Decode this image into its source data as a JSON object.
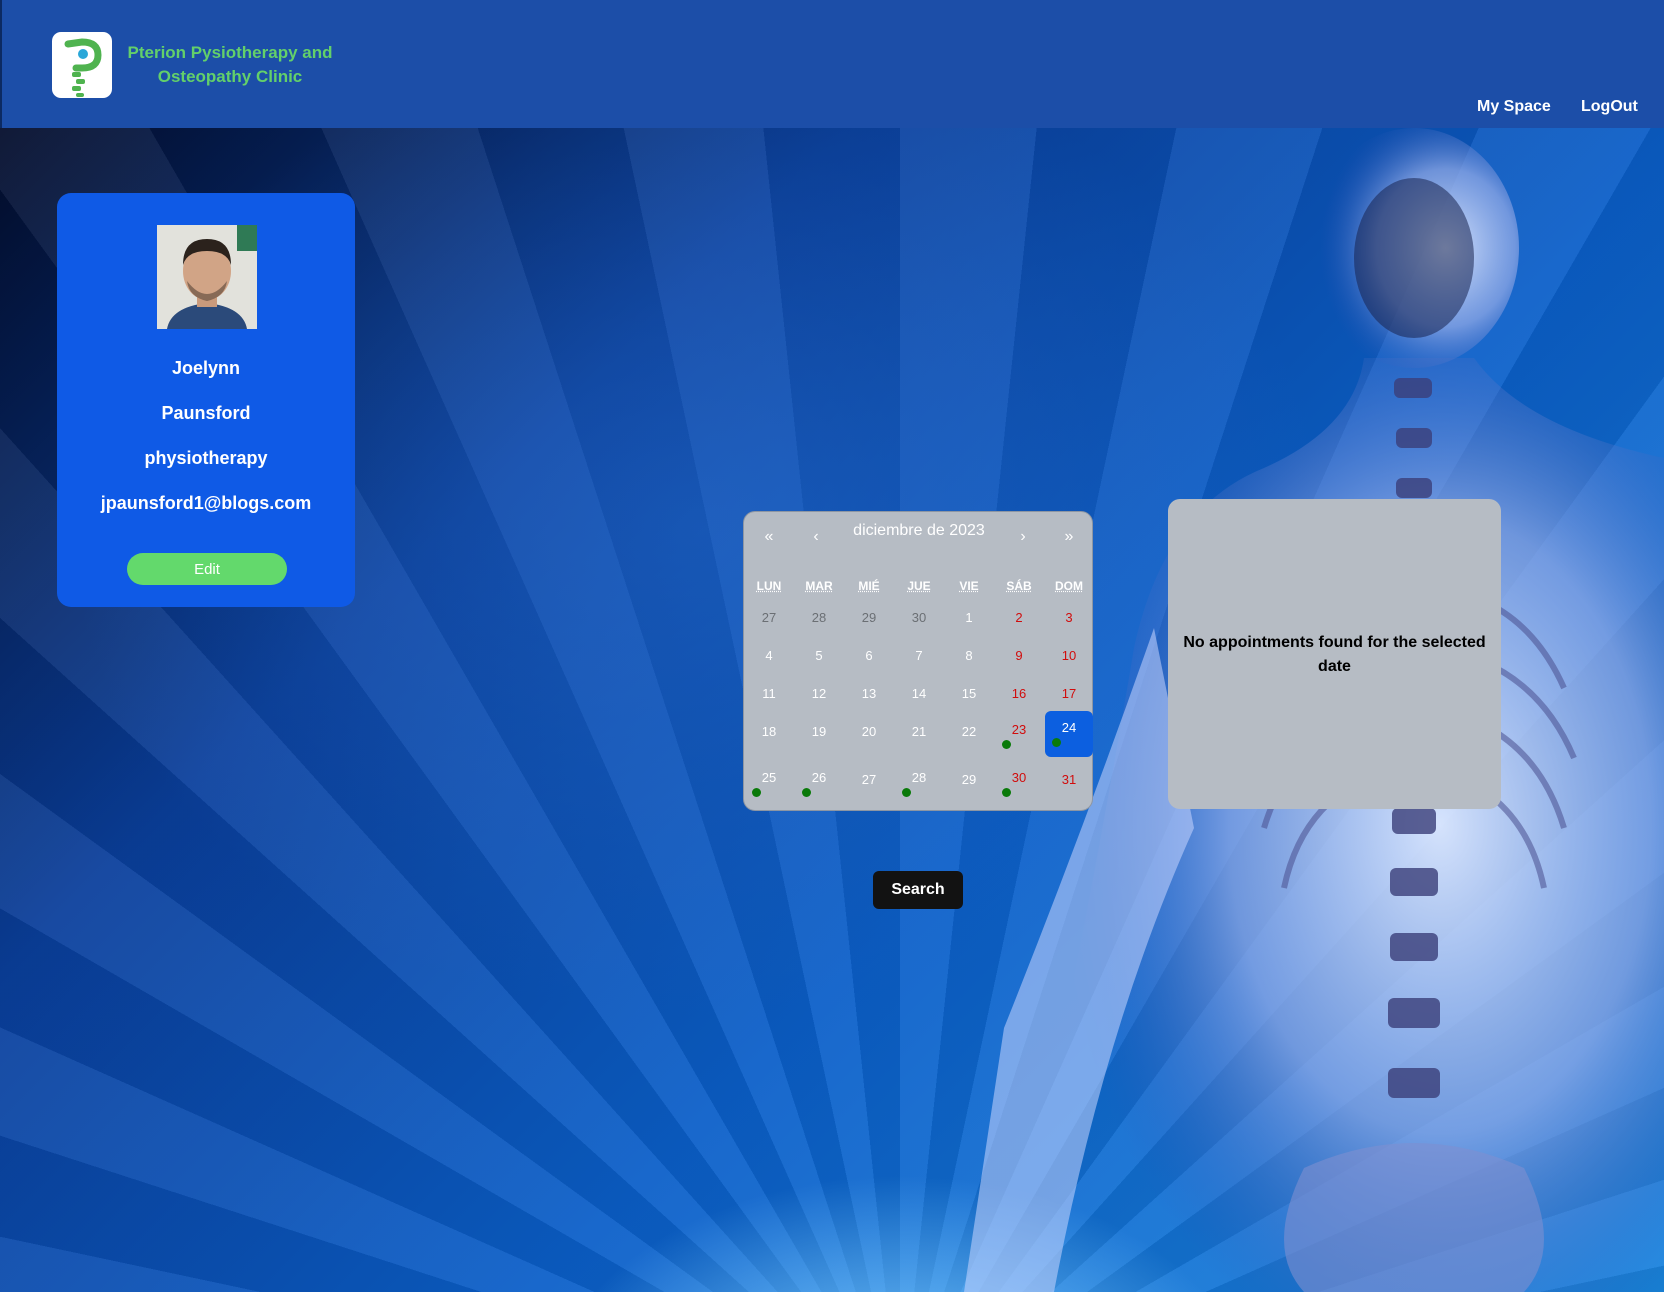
{
  "header": {
    "clinic_name": "Pterion Pysiotherapy and Osteopathy Clinic",
    "nav": {
      "my_space": "My Space",
      "logout": "LogOut"
    },
    "colors": {
      "bar": "#1c4ea8",
      "brand_text": "#63d06a"
    }
  },
  "profile": {
    "first_name": "Joelynn",
    "last_name": "Paunsford",
    "specialty": "physiotherapy",
    "email": "jpaunsford1@blogs.com",
    "edit_label": "Edit"
  },
  "calendar": {
    "title": "diciembre de 2023",
    "nav": {
      "prev_year": "«",
      "prev_month": "‹",
      "next_month": "›",
      "next_year": "»"
    },
    "weekdays": [
      "LUN",
      "MAR",
      "MIÉ",
      "JUE",
      "VIE",
      "SÁB",
      "DOM"
    ],
    "weeks": [
      [
        {
          "d": "27",
          "other": true
        },
        {
          "d": "28",
          "other": true
        },
        {
          "d": "29",
          "other": true
        },
        {
          "d": "30",
          "other": true
        },
        {
          "d": "1"
        },
        {
          "d": "2",
          "weekend": true
        },
        {
          "d": "3",
          "weekend": true
        }
      ],
      [
        {
          "d": "4"
        },
        {
          "d": "5"
        },
        {
          "d": "6"
        },
        {
          "d": "7"
        },
        {
          "d": "8"
        },
        {
          "d": "9",
          "weekend": true
        },
        {
          "d": "10",
          "weekend": true
        }
      ],
      [
        {
          "d": "11"
        },
        {
          "d": "12"
        },
        {
          "d": "13"
        },
        {
          "d": "14"
        },
        {
          "d": "15"
        },
        {
          "d": "16",
          "weekend": true
        },
        {
          "d": "17",
          "weekend": true
        }
      ],
      [
        {
          "d": "18"
        },
        {
          "d": "19"
        },
        {
          "d": "20"
        },
        {
          "d": "21"
        },
        {
          "d": "22"
        },
        {
          "d": "23",
          "weekend": true,
          "dot": true
        },
        {
          "d": "24",
          "weekend": true,
          "dot": true,
          "selected": true
        }
      ],
      [
        {
          "d": "25",
          "dot": true
        },
        {
          "d": "26",
          "dot": true
        },
        {
          "d": "27"
        },
        {
          "d": "28",
          "dot": true
        },
        {
          "d": "29"
        },
        {
          "d": "30",
          "weekend": true,
          "dot": true
        },
        {
          "d": "31",
          "weekend": true
        }
      ]
    ],
    "colors": {
      "selected": "#0c5fe0",
      "weekend": "#d10c0c",
      "dot": "#0a7a0a"
    }
  },
  "appointments": {
    "empty_message": "No appointments found for the selected date"
  },
  "search": {
    "label": "Search"
  }
}
